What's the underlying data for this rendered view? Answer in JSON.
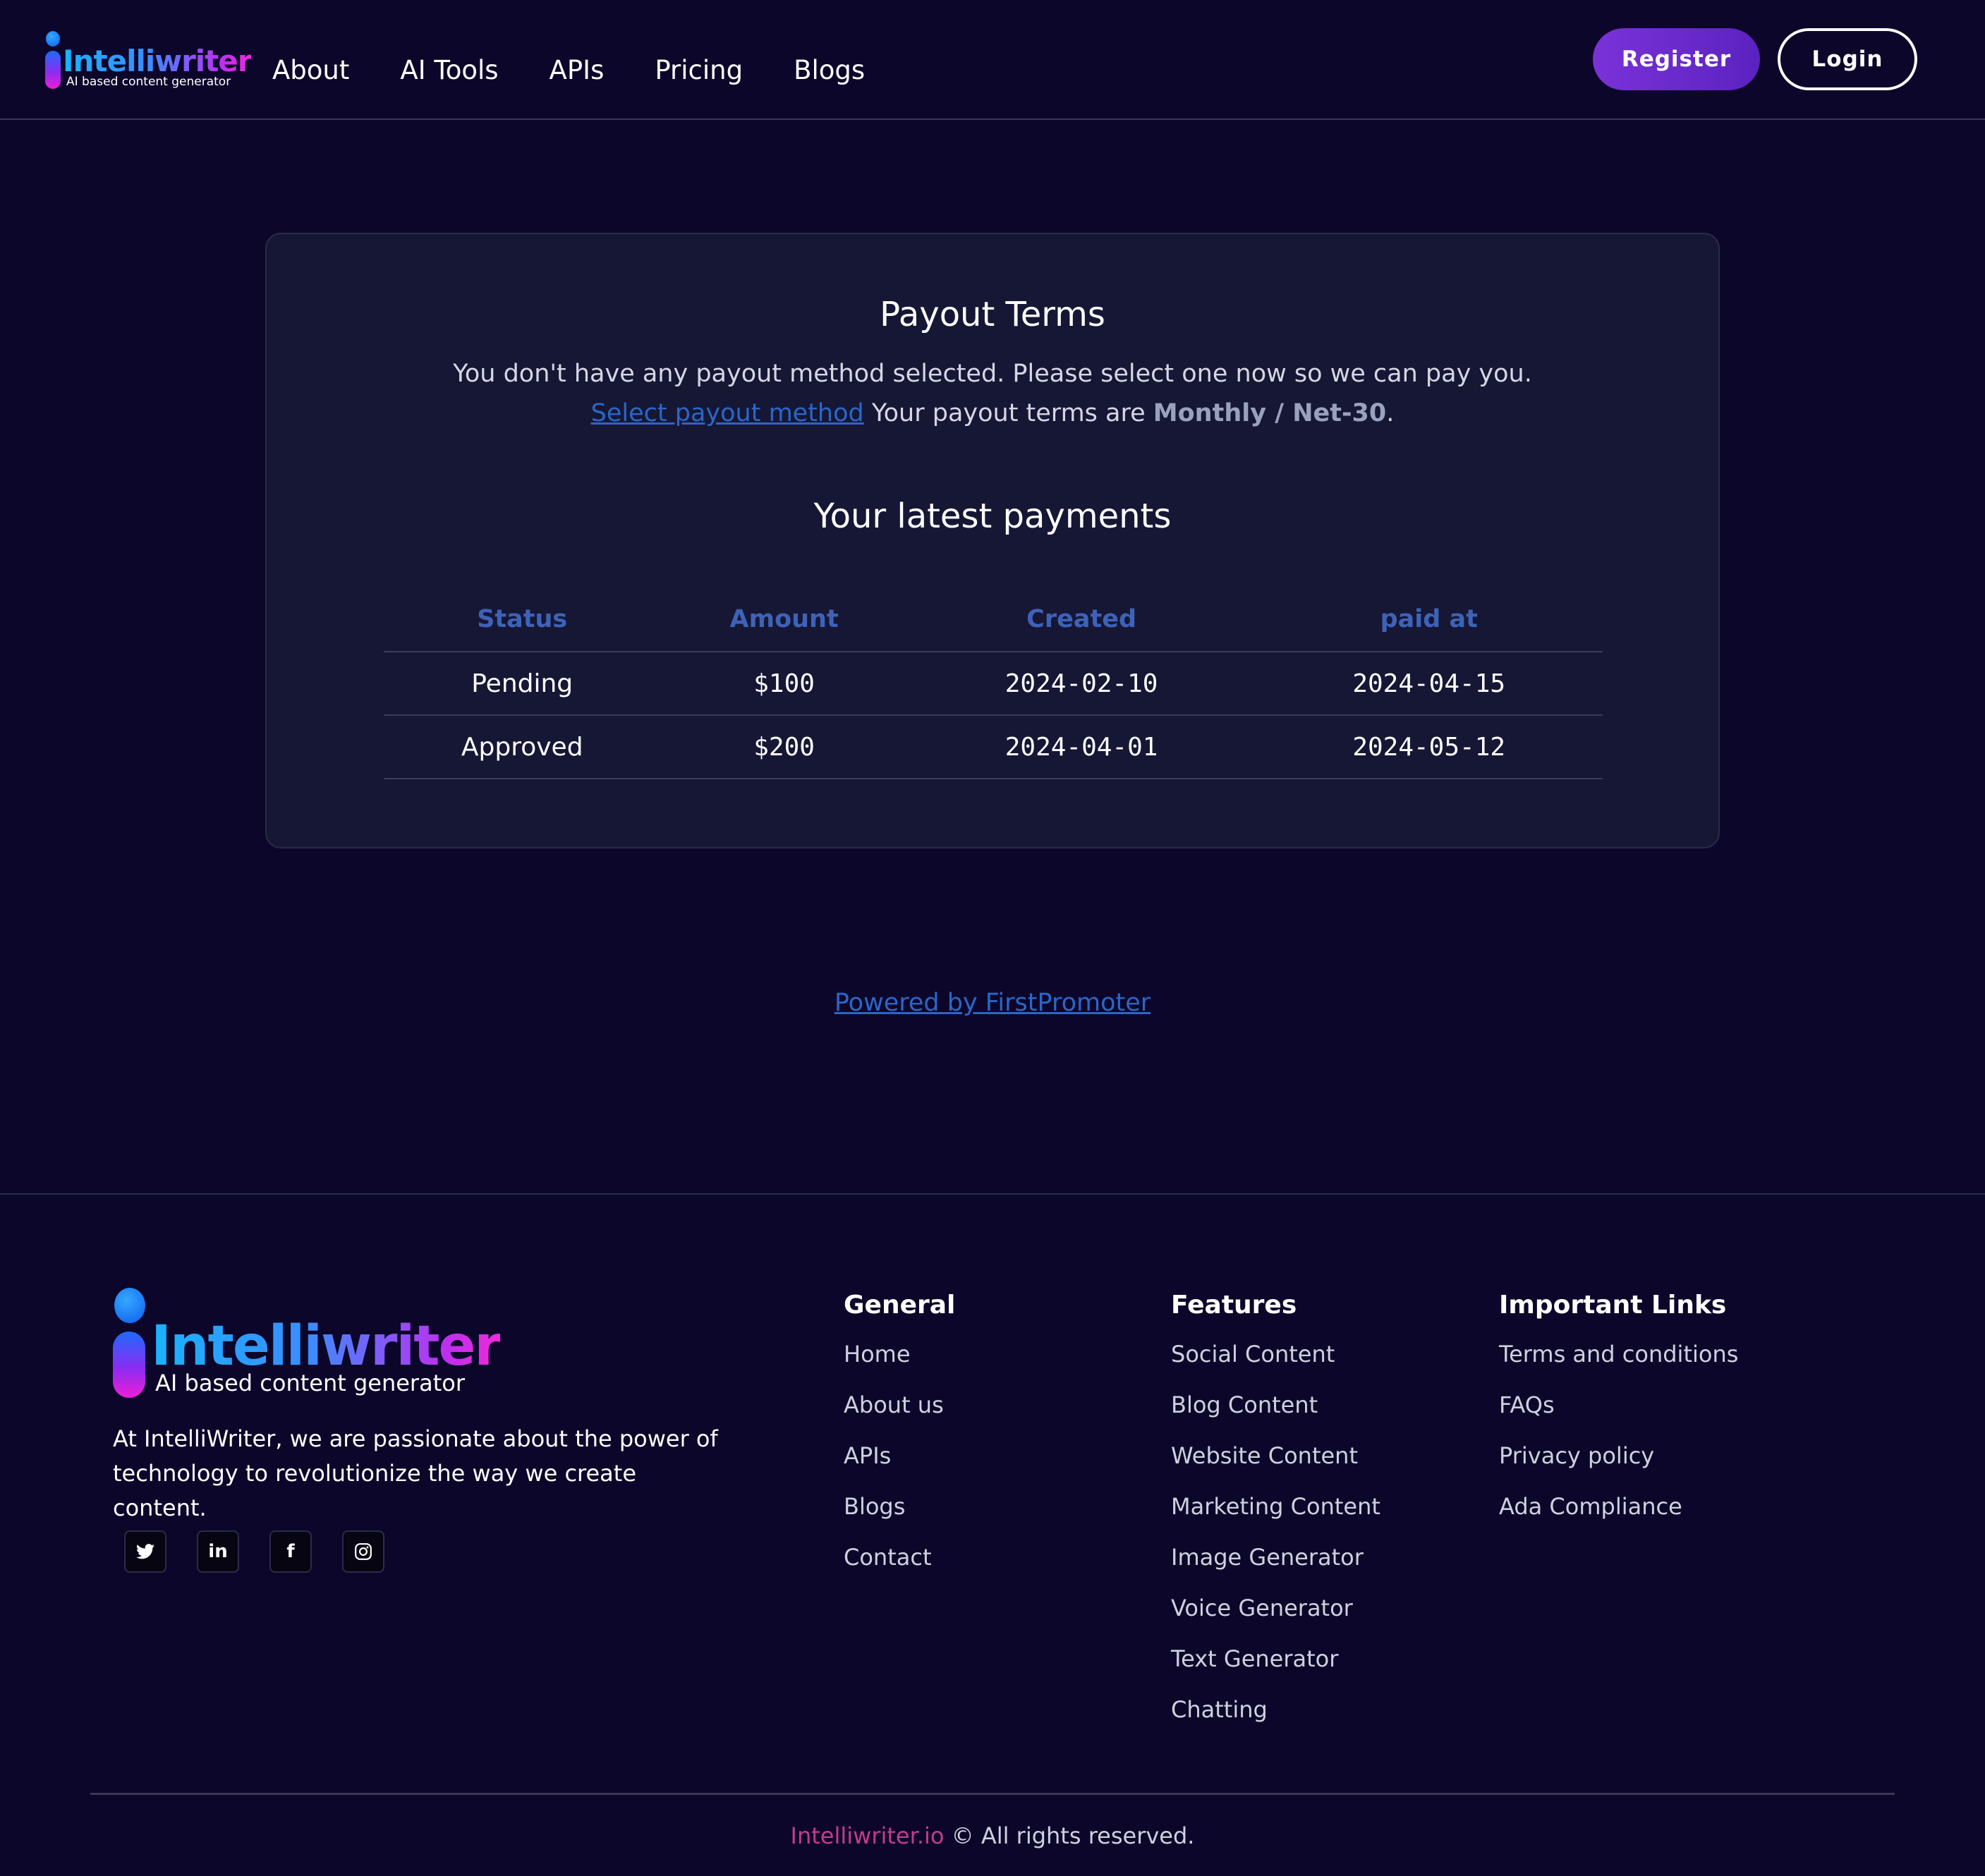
{
  "header": {
    "logo_text": "Intelliwriter",
    "logo_tagline": "AI based content generator",
    "nav": [
      "About",
      "AI Tools",
      "APIs",
      "Pricing",
      "Blogs"
    ],
    "register_label": "Register",
    "login_label": "Login"
  },
  "payout": {
    "title": "Payout Terms",
    "notice": "You don't have any payout method selected. Please select one now so we can pay you.",
    "select_link": "Select payout method",
    "terms_prefix": "Your payout terms are",
    "terms_value": "Monthly / Net-30",
    "terms_suffix": "."
  },
  "payments": {
    "title": "Your latest payments",
    "columns": [
      "Status",
      "Amount",
      "Created",
      "paid at"
    ],
    "rows": [
      [
        "Pending",
        "$100",
        "2024-02-10",
        "2024-04-15"
      ],
      [
        "Approved",
        "$200",
        "2024-04-01",
        "2024-05-12"
      ]
    ]
  },
  "powered_by": "Powered by FirstPromoter",
  "footer": {
    "logo_text": "Intelliwriter",
    "logo_tagline": "AI based content generator",
    "about": "At IntelliWriter, we are passionate about the power of technology to revolutionize the way we create content.",
    "social": [
      {
        "icon": "twitter-icon",
        "glyph": "🐦"
      },
      {
        "icon": "linkedin-icon",
        "glyph": "in"
      },
      {
        "icon": "facebook-icon",
        "glyph": "f"
      },
      {
        "icon": "instagram-icon",
        "glyph": "◎"
      }
    ],
    "general": {
      "title": "General",
      "items": [
        "Home",
        "About us",
        "APIs",
        "Blogs",
        "Contact"
      ]
    },
    "features": {
      "title": "Features",
      "items": [
        "Social Content",
        "Blog Content",
        "Website Content",
        "Marketing Content",
        "Image Generator",
        "Voice Generator",
        "Text Generator",
        "Chatting"
      ]
    },
    "links": {
      "title": "Important Links",
      "items": [
        "Terms and conditions",
        "FAQs",
        "Privacy policy",
        "Ada Compliance"
      ]
    },
    "copyright_brand": "Intelliwriter.io",
    "copyright_text": "© All rights reserved."
  },
  "colors": {
    "background": "#0c072a",
    "card": "#161735",
    "accent_purple": "#7a32d8",
    "link_blue": "#2b66c8",
    "table_header": "#3e62b8",
    "brand_pink": "#c23c8e"
  }
}
